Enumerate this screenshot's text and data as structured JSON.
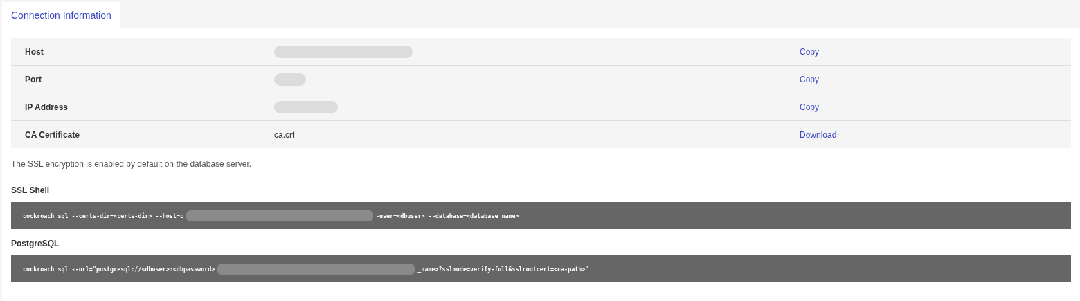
{
  "tabs": [
    {
      "label": "Connection Information",
      "selected": true
    }
  ],
  "connection_table": {
    "rows": [
      {
        "label": "Host",
        "value": {
          "kind": "redacted"
        },
        "action": "Copy"
      },
      {
        "label": "Port",
        "value": {
          "kind": "redacted"
        },
        "action": "Copy"
      },
      {
        "label": "IP Address",
        "value": {
          "kind": "redacted"
        },
        "action": "Copy"
      },
      {
        "label": "CA Certificate",
        "value": {
          "kind": "text",
          "text": "ca.crt"
        },
        "action": "Download"
      }
    ]
  },
  "note": "The SSL encryption is enabled by default on the database server.",
  "commands": [
    {
      "title": "SSL Shell",
      "parts": [
        {
          "kind": "text",
          "text": "cockroach sql --certs-dir=<certs-dir> --host=c"
        },
        {
          "kind": "redacted"
        },
        {
          "kind": "text",
          "text": "-user=<dbuser> --database=<database_name>"
        }
      ]
    },
    {
      "title": "PostgreSQL",
      "parts": [
        {
          "kind": "text",
          "text": "cockroach sql --url=\"postgresql://<dbuser>:<dbpassword>"
        },
        {
          "kind": "redacted"
        },
        {
          "kind": "text",
          "text": "_name>?sslmode=verify-full&sslrootcert=<ca-path>\""
        }
      ]
    }
  ]
}
